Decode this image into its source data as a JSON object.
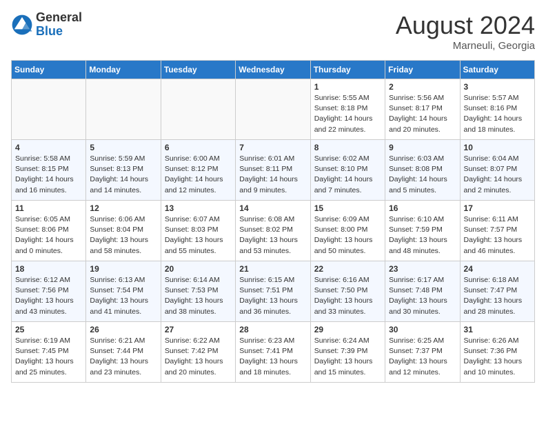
{
  "header": {
    "logo_general": "General",
    "logo_blue": "Blue",
    "month_year": "August 2024",
    "location": "Marneuli, Georgia"
  },
  "weekdays": [
    "Sunday",
    "Monday",
    "Tuesday",
    "Wednesday",
    "Thursday",
    "Friday",
    "Saturday"
  ],
  "weeks": [
    [
      {
        "day": "",
        "info": ""
      },
      {
        "day": "",
        "info": ""
      },
      {
        "day": "",
        "info": ""
      },
      {
        "day": "",
        "info": ""
      },
      {
        "day": "1",
        "info": "Sunrise: 5:55 AM\nSunset: 8:18 PM\nDaylight: 14 hours and 22 minutes."
      },
      {
        "day": "2",
        "info": "Sunrise: 5:56 AM\nSunset: 8:17 PM\nDaylight: 14 hours and 20 minutes."
      },
      {
        "day": "3",
        "info": "Sunrise: 5:57 AM\nSunset: 8:16 PM\nDaylight: 14 hours and 18 minutes."
      }
    ],
    [
      {
        "day": "4",
        "info": "Sunrise: 5:58 AM\nSunset: 8:15 PM\nDaylight: 14 hours and 16 minutes."
      },
      {
        "day": "5",
        "info": "Sunrise: 5:59 AM\nSunset: 8:13 PM\nDaylight: 14 hours and 14 minutes."
      },
      {
        "day": "6",
        "info": "Sunrise: 6:00 AM\nSunset: 8:12 PM\nDaylight: 14 hours and 12 minutes."
      },
      {
        "day": "7",
        "info": "Sunrise: 6:01 AM\nSunset: 8:11 PM\nDaylight: 14 hours and 9 minutes."
      },
      {
        "day": "8",
        "info": "Sunrise: 6:02 AM\nSunset: 8:10 PM\nDaylight: 14 hours and 7 minutes."
      },
      {
        "day": "9",
        "info": "Sunrise: 6:03 AM\nSunset: 8:08 PM\nDaylight: 14 hours and 5 minutes."
      },
      {
        "day": "10",
        "info": "Sunrise: 6:04 AM\nSunset: 8:07 PM\nDaylight: 14 hours and 2 minutes."
      }
    ],
    [
      {
        "day": "11",
        "info": "Sunrise: 6:05 AM\nSunset: 8:06 PM\nDaylight: 14 hours and 0 minutes."
      },
      {
        "day": "12",
        "info": "Sunrise: 6:06 AM\nSunset: 8:04 PM\nDaylight: 13 hours and 58 minutes."
      },
      {
        "day": "13",
        "info": "Sunrise: 6:07 AM\nSunset: 8:03 PM\nDaylight: 13 hours and 55 minutes."
      },
      {
        "day": "14",
        "info": "Sunrise: 6:08 AM\nSunset: 8:02 PM\nDaylight: 13 hours and 53 minutes."
      },
      {
        "day": "15",
        "info": "Sunrise: 6:09 AM\nSunset: 8:00 PM\nDaylight: 13 hours and 50 minutes."
      },
      {
        "day": "16",
        "info": "Sunrise: 6:10 AM\nSunset: 7:59 PM\nDaylight: 13 hours and 48 minutes."
      },
      {
        "day": "17",
        "info": "Sunrise: 6:11 AM\nSunset: 7:57 PM\nDaylight: 13 hours and 46 minutes."
      }
    ],
    [
      {
        "day": "18",
        "info": "Sunrise: 6:12 AM\nSunset: 7:56 PM\nDaylight: 13 hours and 43 minutes."
      },
      {
        "day": "19",
        "info": "Sunrise: 6:13 AM\nSunset: 7:54 PM\nDaylight: 13 hours and 41 minutes."
      },
      {
        "day": "20",
        "info": "Sunrise: 6:14 AM\nSunset: 7:53 PM\nDaylight: 13 hours and 38 minutes."
      },
      {
        "day": "21",
        "info": "Sunrise: 6:15 AM\nSunset: 7:51 PM\nDaylight: 13 hours and 36 minutes."
      },
      {
        "day": "22",
        "info": "Sunrise: 6:16 AM\nSunset: 7:50 PM\nDaylight: 13 hours and 33 minutes."
      },
      {
        "day": "23",
        "info": "Sunrise: 6:17 AM\nSunset: 7:48 PM\nDaylight: 13 hours and 30 minutes."
      },
      {
        "day": "24",
        "info": "Sunrise: 6:18 AM\nSunset: 7:47 PM\nDaylight: 13 hours and 28 minutes."
      }
    ],
    [
      {
        "day": "25",
        "info": "Sunrise: 6:19 AM\nSunset: 7:45 PM\nDaylight: 13 hours and 25 minutes."
      },
      {
        "day": "26",
        "info": "Sunrise: 6:21 AM\nSunset: 7:44 PM\nDaylight: 13 hours and 23 minutes."
      },
      {
        "day": "27",
        "info": "Sunrise: 6:22 AM\nSunset: 7:42 PM\nDaylight: 13 hours and 20 minutes."
      },
      {
        "day": "28",
        "info": "Sunrise: 6:23 AM\nSunset: 7:41 PM\nDaylight: 13 hours and 18 minutes."
      },
      {
        "day": "29",
        "info": "Sunrise: 6:24 AM\nSunset: 7:39 PM\nDaylight: 13 hours and 15 minutes."
      },
      {
        "day": "30",
        "info": "Sunrise: 6:25 AM\nSunset: 7:37 PM\nDaylight: 13 hours and 12 minutes."
      },
      {
        "day": "31",
        "info": "Sunrise: 6:26 AM\nSunset: 7:36 PM\nDaylight: 13 hours and 10 minutes."
      }
    ]
  ]
}
